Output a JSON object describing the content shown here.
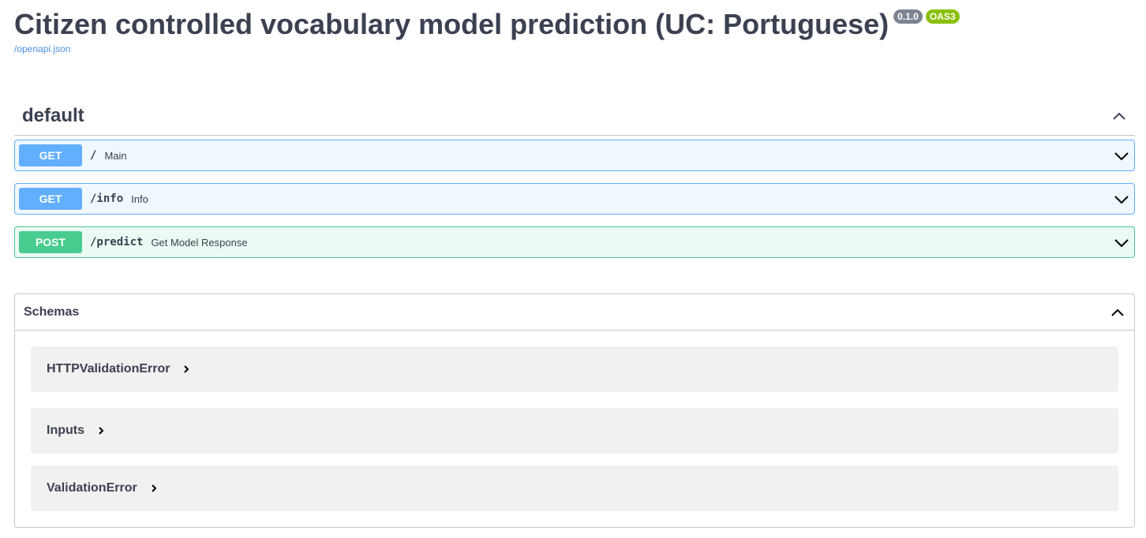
{
  "info": {
    "title": "Citizen controlled vocabulary model prediction (UC: Portuguese)",
    "version": "0.1.0",
    "oas": "OAS3",
    "spec_link": "/openapi.json"
  },
  "tag": {
    "name": "default",
    "icon": "chevron-up-icon"
  },
  "operations": [
    {
      "method": "GET",
      "path": "/",
      "summary": "Main"
    },
    {
      "method": "GET",
      "path": "/info",
      "summary": "Info"
    },
    {
      "method": "POST",
      "path": "/predict",
      "summary": "Get Model Response"
    }
  ],
  "schemas": {
    "title": "Schemas",
    "models": [
      {
        "name": "HTTPValidationError"
      },
      {
        "name": "Inputs"
      },
      {
        "name": "ValidationError"
      }
    ]
  },
  "colors": {
    "get": "#61affe",
    "post": "#49cc90",
    "version_badge": "#7d8492",
    "oas_badge": "#89bf04",
    "link": "#4990e2",
    "text": "#3b4151"
  }
}
